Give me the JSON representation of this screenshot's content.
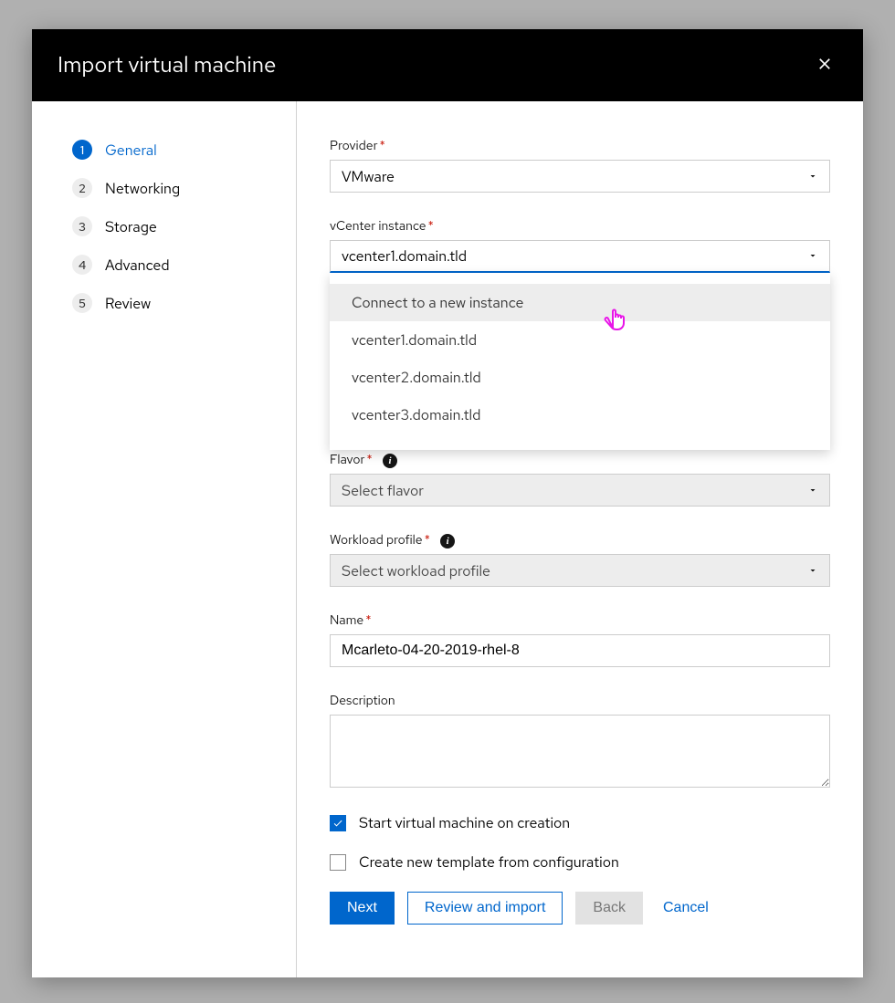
{
  "header": {
    "title": "Import virtual machine"
  },
  "steps": [
    {
      "label": "General"
    },
    {
      "label": "Networking"
    },
    {
      "label": "Storage"
    },
    {
      "label": "Advanced"
    },
    {
      "label": "Review"
    }
  ],
  "form": {
    "provider": {
      "label": "Provider",
      "value": "VMware"
    },
    "vcenter": {
      "label": "vCenter instance",
      "value": "vcenter1.domain.tld",
      "options": [
        "Connect to a new instance",
        "vcenter1.domain.tld",
        "vcenter2.domain.tld",
        "vcenter3.domain.tld"
      ]
    },
    "flavor": {
      "label": "Flavor",
      "value": "Select flavor"
    },
    "workload": {
      "label": "Workload profile",
      "value": "Select workload profile"
    },
    "name": {
      "label": "Name",
      "value": "Mcarleto-04-20-2019-rhel-8"
    },
    "description": {
      "label": "Description",
      "value": ""
    },
    "start_vm": {
      "label": "Start virtual machine on creation"
    },
    "create_template": {
      "label": "Create new template from configuration"
    }
  },
  "buttons": {
    "next": "Next",
    "review": "Review and import",
    "back": "Back",
    "cancel": "Cancel"
  }
}
